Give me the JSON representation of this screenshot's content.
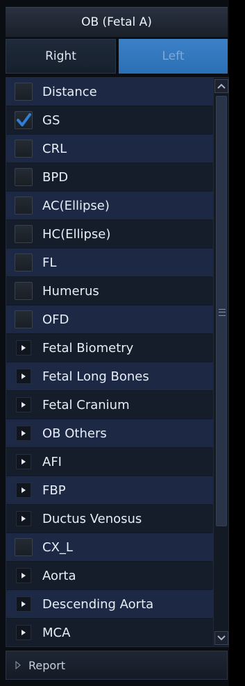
{
  "header": {
    "title": "OB (Fetal A)"
  },
  "tabs": {
    "right_label": "Right",
    "left_label": "Left"
  },
  "list": {
    "items": [
      {
        "label": "Distance",
        "kind": "checkbox",
        "checked": false
      },
      {
        "label": "GS",
        "kind": "checkbox",
        "checked": true
      },
      {
        "label": "CRL",
        "kind": "checkbox",
        "checked": false
      },
      {
        "label": "BPD",
        "kind": "checkbox",
        "checked": false
      },
      {
        "label": "AC(Ellipse)",
        "kind": "checkbox",
        "checked": false
      },
      {
        "label": "HC(Ellipse)",
        "kind": "checkbox",
        "checked": false
      },
      {
        "label": "FL",
        "kind": "checkbox",
        "checked": false
      },
      {
        "label": "Humerus",
        "kind": "checkbox",
        "checked": false
      },
      {
        "label": "OFD",
        "kind": "checkbox",
        "checked": false
      },
      {
        "label": "Fetal Biometry",
        "kind": "group"
      },
      {
        "label": "Fetal Long Bones",
        "kind": "group"
      },
      {
        "label": "Fetal Cranium",
        "kind": "group"
      },
      {
        "label": "OB Others",
        "kind": "group"
      },
      {
        "label": "AFI",
        "kind": "group"
      },
      {
        "label": "FBP",
        "kind": "group"
      },
      {
        "label": "Ductus Venosus",
        "kind": "group"
      },
      {
        "label": "CX_L",
        "kind": "checkbox",
        "checked": false
      },
      {
        "label": "Aorta",
        "kind": "group"
      },
      {
        "label": "Descending Aorta",
        "kind": "group"
      },
      {
        "label": "MCA",
        "kind": "group"
      }
    ]
  },
  "footer": {
    "report_label": "Report"
  },
  "colors": {
    "accent": "#2f74bc",
    "check": "#2f7fd6",
    "row_a": "#1c2844",
    "row_b": "#151c2a"
  }
}
